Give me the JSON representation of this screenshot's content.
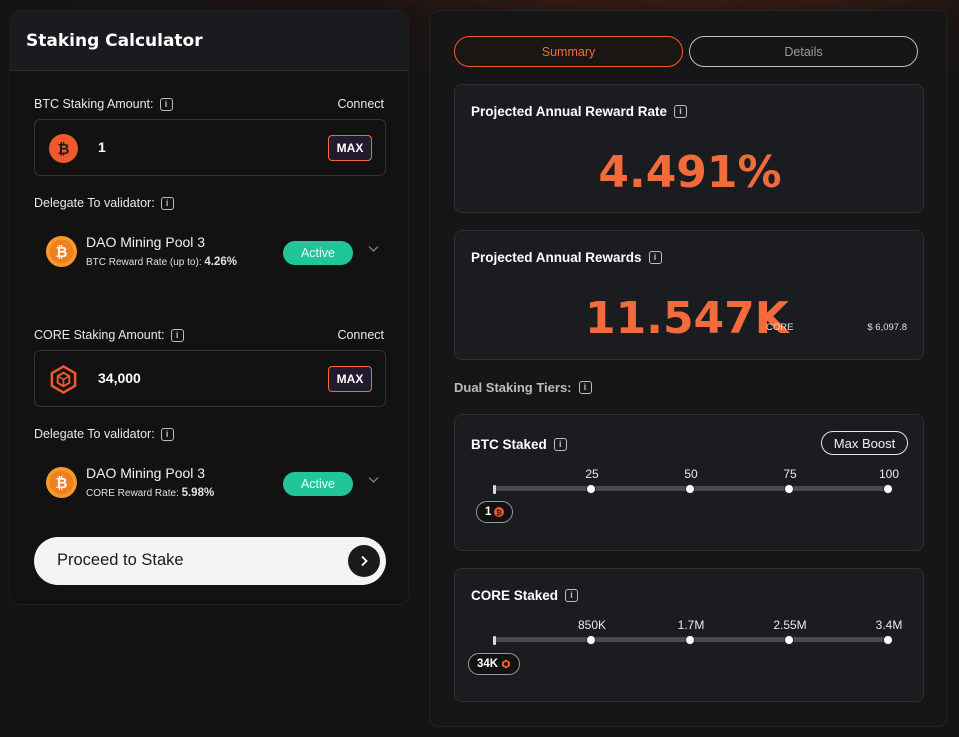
{
  "calculator": {
    "title": "Staking Calculator",
    "btc": {
      "label": "BTC Staking Amount:",
      "connect": "Connect",
      "value": "1",
      "max_label": "MAX",
      "delegate_label": "Delegate To validator:",
      "validator_name": "DAO Mining Pool 3",
      "rate_label": "BTC Reward Rate (up to):",
      "rate_value": "4.26%",
      "status": "Active"
    },
    "core": {
      "label": "CORE Staking Amount:",
      "connect": "Connect",
      "value": "34,000",
      "max_label": "MAX",
      "delegate_label": "Delegate To validator:",
      "validator_name": "DAO Mining Pool 3",
      "rate_label": "CORE Reward Rate:",
      "rate_value": "5.98%",
      "status": "Active"
    },
    "proceed_label": "Proceed to Stake"
  },
  "results": {
    "tabs": [
      {
        "label": "Summary",
        "active": true
      },
      {
        "label": "Details",
        "active": false
      }
    ],
    "annual_rate": {
      "title": "Projected Annual Reward Rate",
      "value": "4.491%"
    },
    "annual_rewards": {
      "title": "Projected Annual Rewards",
      "value": "11.547K",
      "unit": "CORE",
      "usd": "$ 6,097.8"
    },
    "tiers_label": "Dual Staking Tiers:",
    "btc_tier": {
      "title": "BTC Staked",
      "max_boost_label": "Max Boost",
      "ticks": [
        "25",
        "50",
        "75",
        "100"
      ],
      "current_label": "1",
      "current_fraction": 0.01
    },
    "core_tier": {
      "title": "CORE Staked",
      "ticks": [
        "850K",
        "1.7M",
        "2.55M",
        "3.4M"
      ],
      "current_label": "34K",
      "current_fraction": 0.01
    }
  },
  "icons": {
    "info": "info-icon",
    "btc": "bitcoin-icon",
    "core": "core-hexagon-icon",
    "chevron": "chevron-down-icon",
    "arrow": "chevron-right-icon"
  },
  "colors": {
    "accent": "#f36b3a",
    "active": "#20c59a",
    "background": "#141414"
  }
}
